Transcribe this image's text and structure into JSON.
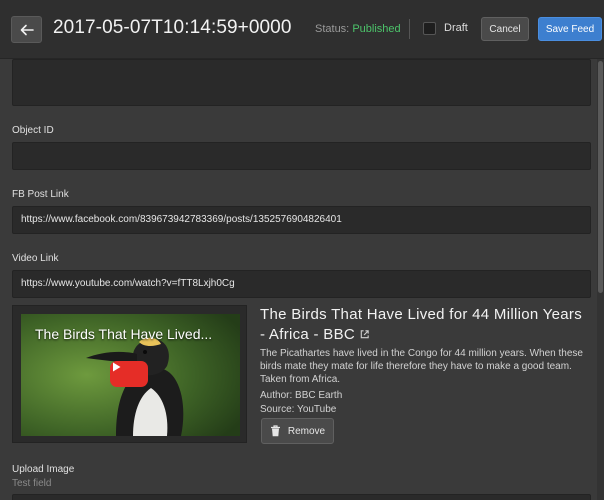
{
  "header": {
    "title": "2017-05-07T10:14:59+0000",
    "status_label": "Status:",
    "status_value": "Published",
    "draft_label": "Draft",
    "cancel_label": "Cancel",
    "save_label": "Save Feed"
  },
  "fields": {
    "object_id": {
      "label": "Object ID",
      "value": ""
    },
    "fb_post_link": {
      "label": "FB Post Link",
      "value": "https://www.facebook.com/839673942783369/posts/1352576904826401"
    },
    "video_link": {
      "label": "Video Link",
      "value": "https://www.youtube.com/watch?v=fTT8Lxjh0Cg"
    },
    "upload_image": {
      "label": "Upload Image",
      "hint": "Test field"
    }
  },
  "video": {
    "thumbnail_title": "The Birds That Have Lived...",
    "title": "The Birds That Have Lived for 44 Million Years - Africa - BBC",
    "description": "The Picathartes have lived in the Congo for 44 million years. When these birds mate they mate for life therefore they have to make a good team. Taken from Africa.",
    "author": "Author: BBC Earth",
    "source": "Source: YouTube",
    "remove_label": "Remove"
  },
  "colors": {
    "status_published": "#4cc36a",
    "primary_button": "#3d7fcf",
    "youtube_red": "#e52d27"
  }
}
